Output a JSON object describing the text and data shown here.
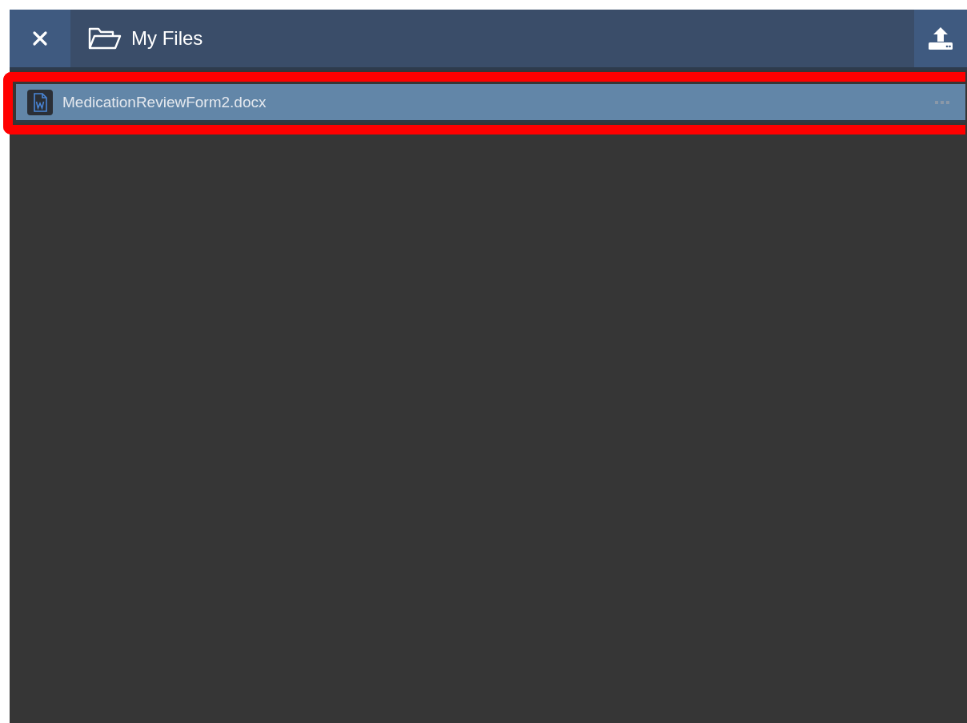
{
  "header": {
    "title": "My Files"
  },
  "files": [
    {
      "name": "MedicationReviewForm2.docx",
      "kind": "docx",
      "selected": true,
      "highlighted": true
    }
  ]
}
